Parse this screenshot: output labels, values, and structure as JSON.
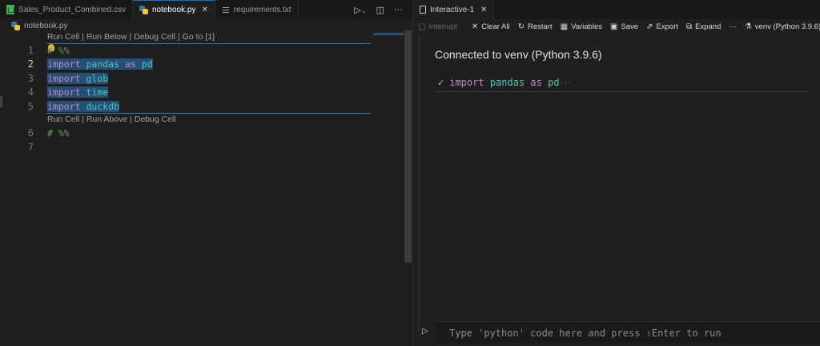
{
  "editor": {
    "tabs": [
      {
        "label": "Sales_Product_Combined.csv",
        "icon": "csv-file-icon"
      },
      {
        "label": "notebook.py",
        "icon": "python-file-icon",
        "active": true
      },
      {
        "label": "requirements.txt",
        "icon": "text-file-icon"
      }
    ],
    "breadcrumb": "notebook.py",
    "codelens_top": "Run Cell | Run Below | Debug Cell | Go to [1]",
    "codelens_bottom": "Run Cell | Run Above | Debug Cell",
    "line_numbers": [
      "1",
      "2",
      "3",
      "4",
      "5",
      "6",
      "7"
    ],
    "current_line": "2",
    "lines": {
      "l1": "# %%",
      "l2_kw": "import",
      "l2_mod": "pandas",
      "l2_as": "as",
      "l2_alias": "pd",
      "l3_kw": "import",
      "l3_mod": "glob",
      "l4_kw": "import",
      "l4_mod": "time",
      "l5_kw": "import",
      "l5_mod": "duckdb",
      "l6": "# %%"
    }
  },
  "interactive": {
    "tab_label": "Interactive-1",
    "toolbar": {
      "interrupt": "Interrupt",
      "clear_all": "Clear All",
      "restart": "Restart",
      "variables": "Variables",
      "save": "Save",
      "export": "Export",
      "expand": "Expand",
      "more": "···",
      "kernel": "venv (Python 3.9.6)"
    },
    "status": "Connected to venv (Python 3.9.6)",
    "executed_cell": {
      "kw": "import",
      "mod": "pandas",
      "as": "as",
      "alias": "pd",
      "more": "···"
    },
    "input_placeholder": "Type 'python' code here and press ⇧Enter to run"
  },
  "colors": {
    "selection": "#264f78",
    "keyword": "#c586c0",
    "module": "#4ec9b0",
    "comment": "#6a9955",
    "success": "#89d185"
  }
}
